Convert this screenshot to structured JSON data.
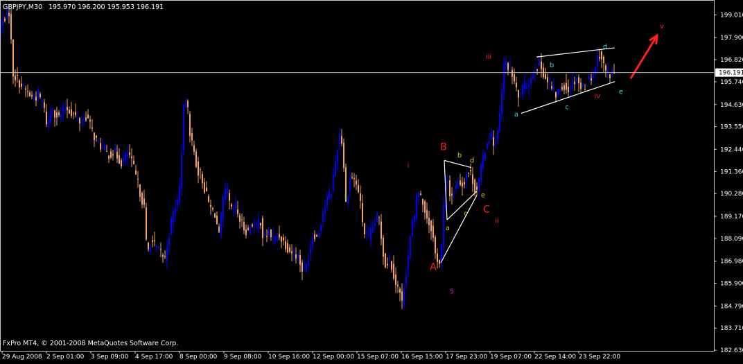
{
  "header": {
    "symbol": "GBPJPY,M30",
    "ohlc": "195.970 196.200 195.953 196.191"
  },
  "footer": {
    "copyright": "FxPro MT4, © 2001-2008 MetaQuotes Software Corp."
  },
  "current_price": {
    "label": "196.191",
    "value": 196.191
  },
  "colors": {
    "background": "#000000",
    "frame": "#c8c8c8",
    "bull": "#0000ff",
    "bear": "#f4a460",
    "price_line": "#c0c0c0",
    "annotation_white": "#ffffff",
    "wave_red": "#ff2020",
    "wave_yellow": "#e0c020",
    "wave_cyan": "#40d0e0",
    "wave_magenta": "#d020d0",
    "wave_green": "#20c040"
  },
  "chart_data": {
    "type": "candlestick",
    "timeframe": "M30",
    "ylim": [
      182.6,
      199.6
    ],
    "xlim": [
      0,
      1030
    ],
    "y_ticks": [
      {
        "label": "199.010",
        "value": 199.01
      },
      {
        "label": "197.900",
        "value": 197.9
      },
      {
        "label": "196.820",
        "value": 196.82
      },
      {
        "label": "195.740",
        "value": 195.74
      },
      {
        "label": "194.630",
        "value": 194.63
      },
      {
        "label": "193.550",
        "value": 193.55
      },
      {
        "label": "192.440",
        "value": 192.44
      },
      {
        "label": "191.360",
        "value": 191.36
      },
      {
        "label": "190.280",
        "value": 190.28
      },
      {
        "label": "189.170",
        "value": 189.17
      },
      {
        "label": "188.090",
        "value": 188.09
      },
      {
        "label": "186.980",
        "value": 186.98
      },
      {
        "label": "185.900",
        "value": 185.9
      },
      {
        "label": "184.790",
        "value": 184.79
      },
      {
        "label": "183.710",
        "value": 183.71
      },
      {
        "label": "182.630",
        "value": 182.63
      }
    ],
    "x_ticks": [
      {
        "label": "29 Aug 2008",
        "bar": 3
      },
      {
        "label": "2 Sep 01:00",
        "bar": 67
      },
      {
        "label": "3 Sep 09:00",
        "bar": 131
      },
      {
        "label": "4 Sep 17:00",
        "bar": 195
      },
      {
        "label": "8 Sep 00:00",
        "bar": 259
      },
      {
        "label": "9 Sep 08:00",
        "bar": 323
      },
      {
        "label": "10 Sep 16:00",
        "bar": 387
      },
      {
        "label": "12 Sep 00:00",
        "bar": 451
      },
      {
        "label": "15 Sep 07:00",
        "bar": 515
      },
      {
        "label": "16 Sep 15:00",
        "bar": 579
      },
      {
        "label": "17 Sep 23:00",
        "bar": 643
      },
      {
        "label": "19 Sep 07:00",
        "bar": 707
      },
      {
        "label": "22 Sep 14:00",
        "bar": 771
      },
      {
        "label": "23 Sep 22:00",
        "bar": 835
      }
    ],
    "path": [
      [
        0,
        198.4
      ],
      [
        8,
        199.0
      ],
      [
        14,
        199.2
      ],
      [
        18,
        196.2
      ],
      [
        30,
        195.6
      ],
      [
        40,
        195.2
      ],
      [
        48,
        194.9
      ],
      [
        55,
        195.1
      ],
      [
        62,
        194.7
      ],
      [
        68,
        193.6
      ],
      [
        75,
        194.4
      ],
      [
        85,
        194.0
      ],
      [
        95,
        194.5
      ],
      [
        105,
        194.2
      ],
      [
        115,
        193.8
      ],
      [
        125,
        194.1
      ],
      [
        132,
        193.4
      ],
      [
        140,
        192.8
      ],
      [
        148,
        192.5
      ],
      [
        155,
        192.2
      ],
      [
        165,
        192.3
      ],
      [
        175,
        191.8
      ],
      [
        185,
        192.3
      ],
      [
        193,
        191.5
      ],
      [
        200,
        190.6
      ],
      [
        208,
        189.6
      ],
      [
        212,
        187.3
      ],
      [
        218,
        188.0
      ],
      [
        226,
        187.6
      ],
      [
        232,
        187.4
      ],
      [
        238,
        187.1
      ],
      [
        245,
        188.6
      ],
      [
        252,
        189.6
      ],
      [
        258,
        190.0
      ],
      [
        262,
        192.4
      ],
      [
        266,
        195.0
      ],
      [
        270,
        194.6
      ],
      [
        275,
        193.0
      ],
      [
        280,
        192.3
      ],
      [
        285,
        191.4
      ],
      [
        290,
        191.2
      ],
      [
        296,
        190.4
      ],
      [
        303,
        189.6
      ],
      [
        310,
        189.3
      ],
      [
        316,
        188.2
      ],
      [
        322,
        190.0
      ],
      [
        328,
        190.4
      ],
      [
        333,
        189.4
      ],
      [
        340,
        189.6
      ],
      [
        346,
        189.0
      ],
      [
        352,
        188.6
      ],
      [
        358,
        188.4
      ],
      [
        363,
        188.9
      ],
      [
        370,
        188.6
      ],
      [
        375,
        189.2
      ],
      [
        380,
        188.0
      ],
      [
        388,
        188.4
      ],
      [
        395,
        188.0
      ],
      [
        402,
        188.3
      ],
      [
        410,
        187.9
      ],
      [
        418,
        187.5
      ],
      [
        424,
        187.4
      ],
      [
        430,
        187.2
      ],
      [
        436,
        186.6
      ],
      [
        440,
        186.5
      ],
      [
        446,
        187.4
      ],
      [
        452,
        188.4
      ],
      [
        458,
        188.1
      ],
      [
        465,
        189.3
      ],
      [
        472,
        190.0
      ],
      [
        478,
        190.4
      ],
      [
        485,
        192.1
      ],
      [
        490,
        193.2
      ],
      [
        495,
        192.6
      ],
      [
        498,
        189.6
      ],
      [
        502,
        190.4
      ],
      [
        506,
        191.2
      ],
      [
        512,
        190.9
      ],
      [
        518,
        190.3
      ],
      [
        525,
        188.4
      ],
      [
        532,
        188.1
      ],
      [
        540,
        188.8
      ],
      [
        546,
        189.3
      ],
      [
        552,
        187.6
      ],
      [
        556,
        186.8
      ],
      [
        562,
        187.1
      ],
      [
        567,
        186.5
      ],
      [
        572,
        185.8
      ],
      [
        576,
        185.6
      ],
      [
        580,
        184.9
      ],
      [
        585,
        186.3
      ],
      [
        590,
        187.4
      ],
      [
        594,
        188.8
      ],
      [
        598,
        189.0
      ],
      [
        602,
        190.6
      ],
      [
        606,
        190.2
      ],
      [
        612,
        189.6
      ],
      [
        618,
        188.9
      ],
      [
        623,
        188.6
      ],
      [
        628,
        187.3
      ],
      [
        634,
        186.9
      ],
      [
        637,
        187.7
      ],
      [
        640,
        189.6
      ],
      [
        644,
        191.2
      ],
      [
        650,
        190.1
      ],
      [
        656,
        190.5
      ],
      [
        662,
        190.9
      ],
      [
        668,
        190.7
      ],
      [
        674,
        191.4
      ],
      [
        680,
        191.2
      ],
      [
        686,
        190.4
      ],
      [
        690,
        190.7
      ],
      [
        694,
        191.5
      ],
      [
        698,
        192.2
      ],
      [
        703,
        192.8
      ],
      [
        708,
        193.2
      ],
      [
        714,
        192.6
      ],
      [
        719,
        193.4
      ],
      [
        724,
        195.2
      ],
      [
        728,
        196.8
      ],
      [
        733,
        196.5
      ],
      [
        738,
        196.2
      ],
      [
        743,
        195.6
      ],
      [
        748,
        194.9
      ],
      [
        754,
        195.4
      ],
      [
        760,
        195.6
      ],
      [
        766,
        195.9
      ],
      [
        772,
        196.4
      ],
      [
        778,
        196.6
      ],
      [
        784,
        196.2
      ],
      [
        790,
        195.7
      ],
      [
        796,
        195.4
      ],
      [
        802,
        195.1
      ],
      [
        808,
        195.4
      ],
      [
        814,
        195.6
      ],
      [
        820,
        195.3
      ],
      [
        826,
        195.7
      ],
      [
        832,
        196.0
      ],
      [
        838,
        195.4
      ],
      [
        844,
        195.6
      ],
      [
        850,
        195.9
      ],
      [
        856,
        196.1
      ],
      [
        862,
        196.9
      ],
      [
        866,
        197.2
      ],
      [
        870,
        196.6
      ],
      [
        874,
        196.3
      ],
      [
        878,
        196.1
      ],
      [
        884,
        196.2
      ],
      [
        888,
        196.191
      ]
    ],
    "annotations": [
      {
        "text": "iii",
        "bar": 705,
        "price": 196.85,
        "color": "red"
      },
      {
        "text": "b",
        "bar": 796,
        "price": 196.45,
        "color": "cyan"
      },
      {
        "text": "d",
        "bar": 873,
        "price": 197.35,
        "color": "cyan"
      },
      {
        "text": "v",
        "bar": 955,
        "price": 198.35,
        "color": "red"
      },
      {
        "text": "iv",
        "bar": 862,
        "price": 194.95,
        "color": "red"
      },
      {
        "text": "e",
        "bar": 896,
        "price": 195.15,
        "color": "cyan"
      },
      {
        "text": "c",
        "bar": 818,
        "price": 194.4,
        "color": "cyan"
      },
      {
        "text": "a",
        "bar": 745,
        "price": 194.05,
        "color": "cyan"
      },
      {
        "text": "B",
        "bar": 640,
        "price": 192.4,
        "color": "red"
      },
      {
        "text": "b",
        "bar": 663,
        "price": 192.05,
        "color": "yellow"
      },
      {
        "text": "d",
        "bar": 681,
        "price": 191.8,
        "color": "yellow"
      },
      {
        "text": "i",
        "bar": 589,
        "price": 191.55,
        "color": "red"
      },
      {
        "text": "i",
        "bar": 498,
        "price": 190.0,
        "color": "green"
      },
      {
        "text": "e",
        "bar": 697,
        "price": 190.1,
        "color": "yellow"
      },
      {
        "text": "C",
        "bar": 702,
        "price": 189.35,
        "color": "red"
      },
      {
        "text": "c",
        "bar": 672,
        "price": 189.2,
        "color": "yellow"
      },
      {
        "text": "ii",
        "bar": 717,
        "price": 188.85,
        "color": "red"
      },
      {
        "text": "a",
        "bar": 646,
        "price": 188.5,
        "color": "yellow"
      },
      {
        "text": "A",
        "bar": 625,
        "price": 186.55,
        "color": "red"
      },
      {
        "text": "5",
        "bar": 652,
        "price": 185.4,
        "color": "magenta"
      }
    ],
    "trend_lines": [
      {
        "from": [
          774,
          196.95
        ],
        "to": [
          887,
          197.4
        ],
        "color": "white"
      },
      {
        "from": [
          752,
          194.2
        ],
        "to": [
          887,
          195.75
        ],
        "color": "white"
      },
      {
        "from": [
          641,
          191.9
        ],
        "to": [
          680,
          191.55
        ],
        "color": "white"
      },
      {
        "from": [
          645,
          189.0
        ],
        "to": [
          688,
          190.4
        ],
        "color": "white"
      },
      {
        "from": [
          636,
          186.9
        ],
        "to": [
          688,
          190.2
        ],
        "color": "white"
      },
      {
        "from": [
          641,
          191.9
        ],
        "to": [
          645,
          189.0
        ],
        "color": "white"
      }
    ],
    "arrow": {
      "from": [
        910,
        195.9
      ],
      "to": [
        948,
        198.0
      ],
      "color": "red"
    }
  }
}
